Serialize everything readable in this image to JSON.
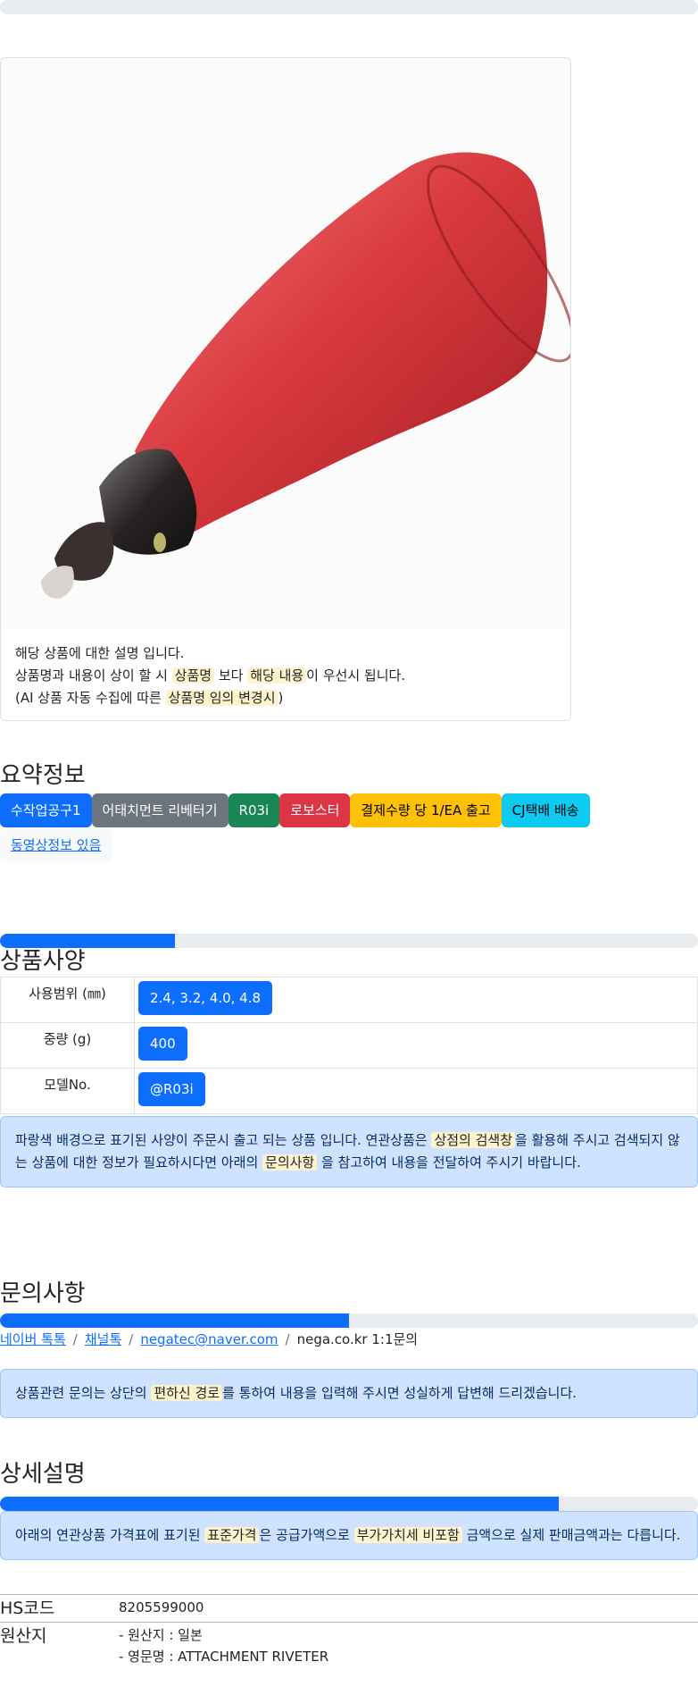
{
  "progress_top": {
    "value": 0
  },
  "product_card": {
    "image_alt_icon": "riveter-tool-image",
    "line1": "해당 상품에 대한 설명 입니다.",
    "line2_pre": "상품명과 내용이 상이 할 시 ",
    "line2_mark1": "상품명",
    "line2_mid": " 보다 ",
    "line2_mark2": "해당 내용",
    "line2_post": "이 우선시 됩니다.",
    "line3_pre": "(AI 상품 자동 수집에 따른 ",
    "line3_mark": "상품명 임의 변경시",
    "line3_post": ")"
  },
  "summary": {
    "title": "요약정보",
    "badges": [
      {
        "label": "수작업공구1",
        "color": "#0d6efd"
      },
      {
        "label": "어태치먼트 리베터기",
        "color": "#6c757d"
      },
      {
        "label": "R03i",
        "color": "#198754"
      },
      {
        "label": "로보스터",
        "color": "#dc3545"
      },
      {
        "label": "결제수량 당 1/EA 출고",
        "color": "#ffc107"
      },
      {
        "label": "CJ택배 배송",
        "color": "#0dcaf0"
      }
    ],
    "video_link": "동영상정보 있음"
  },
  "spec": {
    "progress": {
      "value": 0.25
    },
    "title": "상품사양",
    "rows": [
      {
        "key": "사용범위 (㎜)",
        "value": "2.4, 3.2, 4.0, 4.8"
      },
      {
        "key": "중량 (g)",
        "value": "400"
      },
      {
        "key": "모델No.",
        "value": "@R03i"
      }
    ],
    "alert": {
      "pre": "파랑색 배경으로 표기된 사양이 주문시 출고 되는 상품 입니다. 연관상품은 ",
      "mark1": "상점의 검색창",
      "mid": "을 활용해 주시고 검색되지 않는 상품에 대한 정보가 필요하시다면 아래의 ",
      "mark2": "문의사항",
      "post": " 을 참고하여 내용을 전달하여 주시기 바랍니다."
    }
  },
  "inquiry": {
    "title": "문의사항",
    "progress": {
      "value": 0.5
    },
    "crumbs": [
      "네이버 톡톡",
      "채널톡",
      "negatec@naver.com"
    ],
    "crumb_last": "nega.co.kr 1:1문의",
    "alert": {
      "pre": "상품관련 문의는 상단의 ",
      "mark": "편하신 경로",
      "post": "를 통하여 내용을 입력해 주시면 성실하게 답변해 드리겠습니다."
    }
  },
  "detail": {
    "title": "상세설명",
    "progress": {
      "value": 0.8
    },
    "alert": {
      "pre": "아래의 연관상품 가격표에 표기된 ",
      "mark1": "표준가격",
      "mid": "은 공급가액으로 ",
      "mark2": "부가가치세 비포함",
      "post": " 금액으로 실제 판매금액과는 다릅니다."
    },
    "rows": [
      {
        "key": "HS코드",
        "lines": [
          "8205599000"
        ]
      },
      {
        "key": "원산지",
        "lines": [
          "- 원산지 : 일본",
          "- 영문명 : ATTACHMENT RIVETER"
        ]
      }
    ]
  }
}
